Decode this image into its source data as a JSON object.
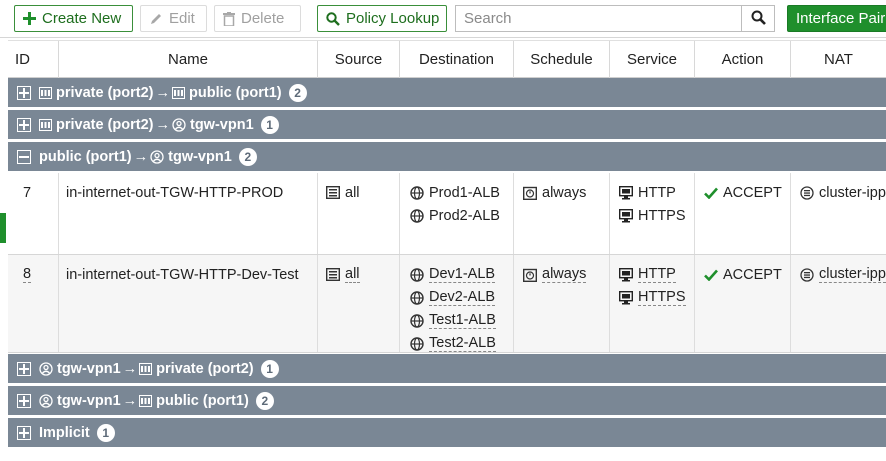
{
  "toolbar": {
    "create_new": "Create New",
    "edit": "Edit",
    "delete": "Delete",
    "policy_lookup": "Policy Lookup",
    "search_placeholder": "Search",
    "interface_pair": "Interface Pair"
  },
  "columns": [
    "ID",
    "Name",
    "Source",
    "Destination",
    "Schedule",
    "Service",
    "Action",
    "NAT"
  ],
  "groups": [
    {
      "from": "private (port2)",
      "to": "public (port1)",
      "count": "2",
      "expanded": false
    },
    {
      "from": "private (port2)",
      "to": "tgw-vpn1",
      "count": "1",
      "expanded": false
    },
    {
      "from": "public (port1)",
      "to": "tgw-vpn1",
      "count": "2",
      "expanded": true
    },
    {
      "from": "tgw-vpn1",
      "to": "private (port2)",
      "count": "1",
      "expanded": false
    },
    {
      "from": "tgw-vpn1",
      "to": "public (port1)",
      "count": "2",
      "expanded": false
    },
    {
      "label": "Implicit",
      "count": "1",
      "expanded": false
    }
  ],
  "arrow": "→",
  "policies": [
    {
      "id": "7",
      "name": "in-internet-out-TGW-HTTP-PROD",
      "source": "all",
      "destinations": [
        "Prod1-ALB",
        "Prod2-ALB"
      ],
      "schedule": "always",
      "services": [
        "HTTP",
        "HTTPS"
      ],
      "action": "ACCEPT",
      "nat": "cluster-ipp"
    },
    {
      "id": "8",
      "name": "in-internet-out-TGW-HTTP-Dev-Test",
      "source": "all",
      "destinations": [
        "Dev1-ALB",
        "Dev2-ALB",
        "Test1-ALB",
        "Test2-ALB"
      ],
      "schedule": "always",
      "services": [
        "HTTP",
        "HTTPS"
      ],
      "action": "ACCEPT",
      "nat": "cluster-ipp"
    }
  ],
  "colors": {
    "accent": "#1f8f2c",
    "group_bg": "#7a8795"
  }
}
